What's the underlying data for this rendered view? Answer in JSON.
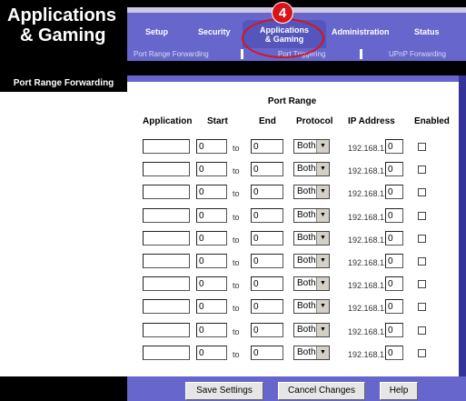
{
  "header": {
    "section_title_line1": "Applications",
    "section_title_line2": "& Gaming",
    "tabs": [
      {
        "label": "Setup"
      },
      {
        "label": "Security"
      },
      {
        "label": "Applications & Gaming",
        "line1": "Applications",
        "line2": "& Gaming",
        "active": true
      },
      {
        "label": "Administration"
      },
      {
        "label": "Status"
      }
    ],
    "subtabs": [
      {
        "label": "Port Range Forwarding"
      },
      {
        "label": "Port Triggering"
      },
      {
        "label": "UPnP Forwarding"
      }
    ],
    "callout_number": "4"
  },
  "sidebar": {
    "title": "Port Range Forwarding"
  },
  "form": {
    "title": "Port Range",
    "columns": {
      "application": "Application",
      "start": "Start",
      "end": "End",
      "protocol": "Protocol",
      "ip_address": "IP Address",
      "enabled": "Enabled"
    },
    "to_label": "to",
    "ip_prefix": "192.168.1.",
    "rows": [
      {
        "application": "",
        "start": "0",
        "end": "0",
        "protocol": "Both",
        "ip_last": "0",
        "enabled": false
      },
      {
        "application": "",
        "start": "0",
        "end": "0",
        "protocol": "Both",
        "ip_last": "0",
        "enabled": false
      },
      {
        "application": "",
        "start": "0",
        "end": "0",
        "protocol": "Both",
        "ip_last": "0",
        "enabled": false
      },
      {
        "application": "",
        "start": "0",
        "end": "0",
        "protocol": "Both",
        "ip_last": "0",
        "enabled": false
      },
      {
        "application": "",
        "start": "0",
        "end": "0",
        "protocol": "Both",
        "ip_last": "0",
        "enabled": false
      },
      {
        "application": "",
        "start": "0",
        "end": "0",
        "protocol": "Both",
        "ip_last": "0",
        "enabled": false
      },
      {
        "application": "",
        "start": "0",
        "end": "0",
        "protocol": "Both",
        "ip_last": "0",
        "enabled": false
      },
      {
        "application": "",
        "start": "0",
        "end": "0",
        "protocol": "Both",
        "ip_last": "0",
        "enabled": false
      },
      {
        "application": "",
        "start": "0",
        "end": "0",
        "protocol": "Both",
        "ip_last": "0",
        "enabled": false
      },
      {
        "application": "",
        "start": "0",
        "end": "0",
        "protocol": "Both",
        "ip_last": "0",
        "enabled": false
      }
    ]
  },
  "footer": {
    "save_label": "Save Settings",
    "cancel_label": "Cancel Changes",
    "help_label": "Help"
  },
  "colors": {
    "nav_purple": "#6666cc",
    "callout_red": "#d8141b"
  }
}
